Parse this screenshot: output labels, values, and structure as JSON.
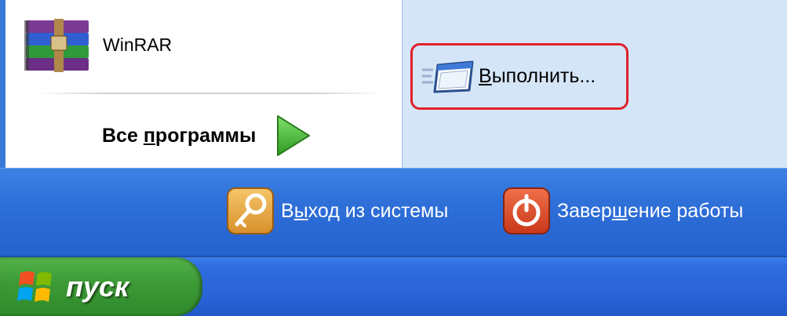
{
  "start_menu": {
    "pinned_program": {
      "label": "WinRAR",
      "icon": "winrar-icon"
    },
    "all_programs": {
      "label_prefix": "Все ",
      "label_underlined": "п",
      "label_suffix": "рограммы",
      "icon": "green-arrow-icon"
    },
    "run": {
      "label_underlined": "В",
      "label_suffix": "ыполнить...",
      "icon": "run-window-icon",
      "highlight_color": "#e0202a"
    },
    "logoff": {
      "label_prefix": "В",
      "label_underlined": "ы",
      "label_suffix": "ход из системы",
      "icon": "key-icon"
    },
    "shutdown": {
      "label_prefix": "Завер",
      "label_underlined": "ш",
      "label_suffix": "ение работы",
      "icon": "power-icon"
    }
  },
  "taskbar": {
    "start_label": "пуск",
    "start_icon": "windows-flag-icon"
  },
  "colors": {
    "menu_blue": "#2e6fd8",
    "right_panel": "#d5e5f8",
    "start_green": "#3c9a36"
  }
}
